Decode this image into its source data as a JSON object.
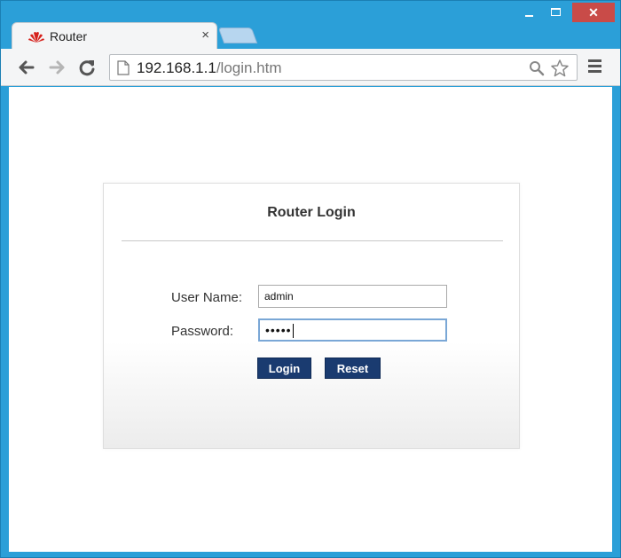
{
  "browser": {
    "tab_title": "Router",
    "tab_close": "×",
    "window_close": "✕",
    "url_host": "192.168.1.1",
    "url_path": "/login.htm"
  },
  "login": {
    "title": "Router Login",
    "username_label": "User Name:",
    "username_value": "admin",
    "password_label": "Password:",
    "password_value": "•••••",
    "login_button": "Login",
    "reset_button": "Reset"
  },
  "colors": {
    "window_frame": "#2b9fd8",
    "button_bg": "#1a3b70",
    "close_button": "#c94b48"
  },
  "icons": [
    "huawei-logo-icon",
    "back-arrow-icon",
    "forward-arrow-icon",
    "reload-icon",
    "page-icon",
    "search-icon",
    "star-icon",
    "menu-icon",
    "minimize-icon",
    "maximize-icon",
    "close-icon"
  ]
}
